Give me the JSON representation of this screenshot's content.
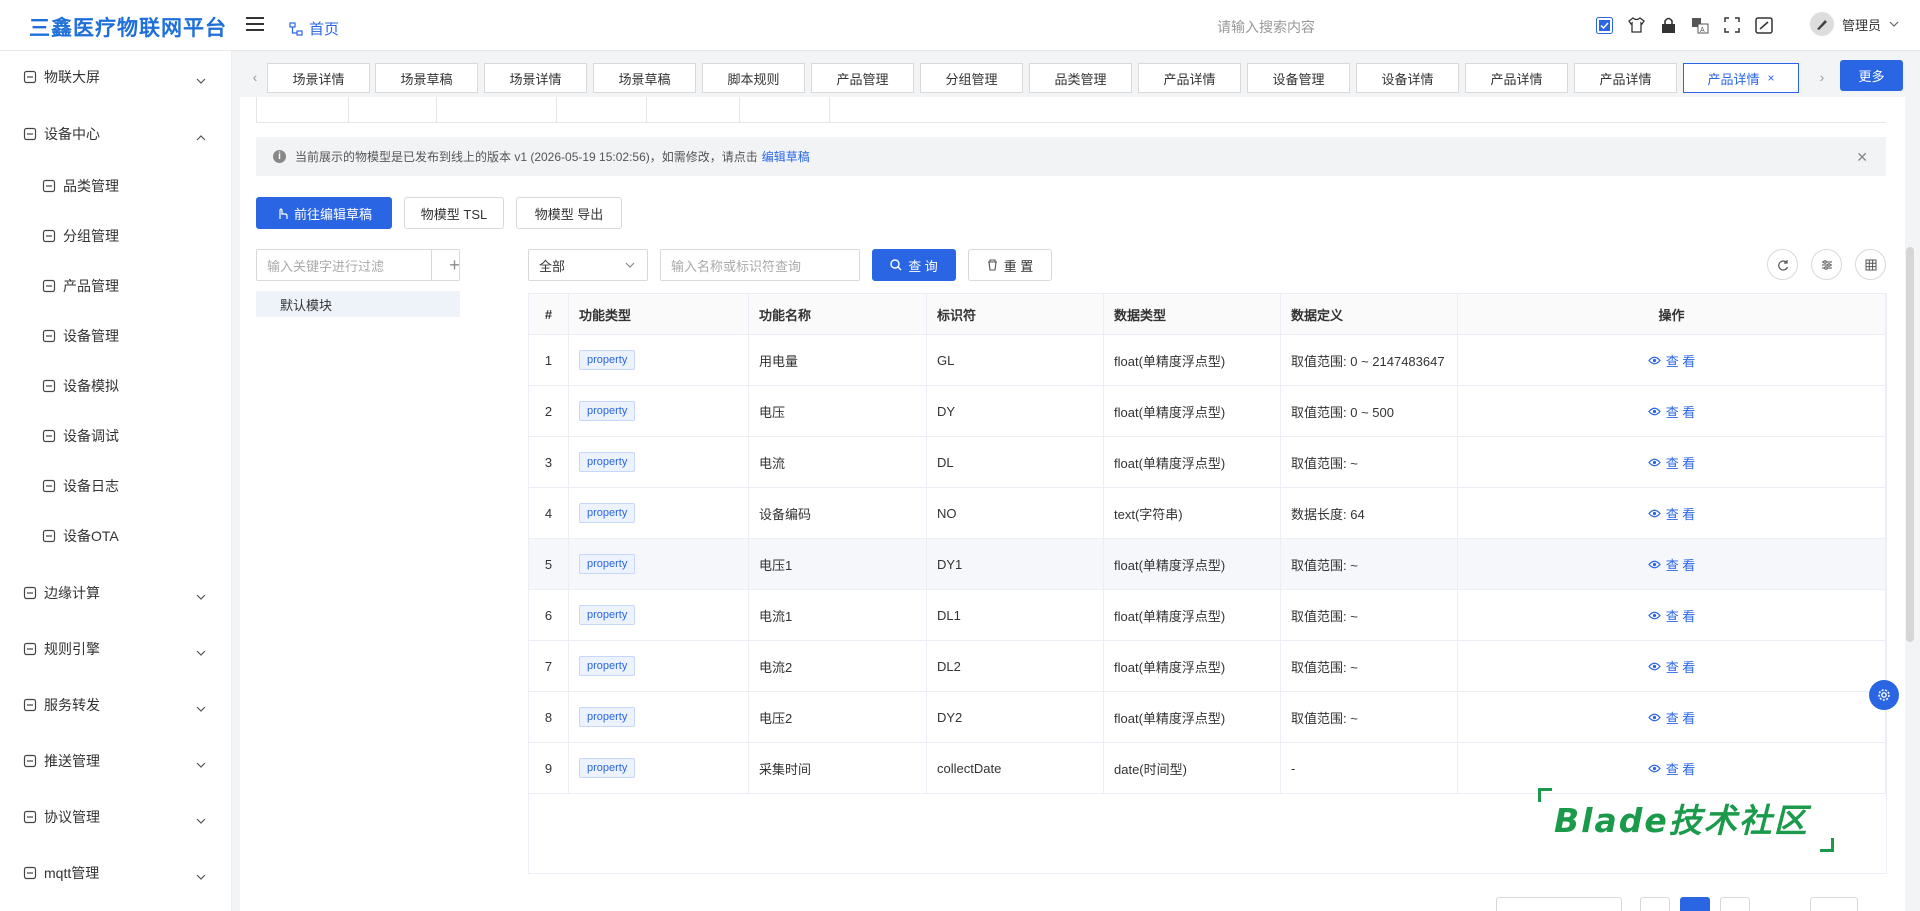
{
  "header": {
    "logo": "三鑫医疗物联网平台",
    "home_label": "首页",
    "search_placeholder": "请输入搜索内容",
    "username": "管理员"
  },
  "sidebar": {
    "items": [
      {
        "label": "物联大屏",
        "icon": "dashboard-icon",
        "chevron": "down"
      },
      {
        "label": "设备中心",
        "icon": "device-center-icon",
        "chevron": "up"
      },
      {
        "label": "品类管理",
        "icon": "cube-icon",
        "sub": true
      },
      {
        "label": "分组管理",
        "icon": "server-icon",
        "sub": true
      },
      {
        "label": "产品管理",
        "icon": "tools-icon",
        "sub": true
      },
      {
        "label": "设备管理",
        "icon": "monitor-icon",
        "sub": true
      },
      {
        "label": "设备模拟",
        "icon": "simulate-icon",
        "sub": true
      },
      {
        "label": "设备调试",
        "icon": "debug-icon",
        "sub": true
      },
      {
        "label": "设备日志",
        "icon": "log-icon",
        "sub": true
      },
      {
        "label": "设备OTA",
        "icon": "ota-icon",
        "sub": true
      },
      {
        "label": "边缘计算",
        "icon": "edge-icon",
        "chevron": "down"
      },
      {
        "label": "规则引擎",
        "icon": "rule-icon",
        "chevron": "down"
      },
      {
        "label": "服务转发",
        "icon": "forward-icon",
        "chevron": "down"
      },
      {
        "label": "推送管理",
        "icon": "bell-icon",
        "chevron": "down"
      },
      {
        "label": "协议管理",
        "icon": "antenna-icon",
        "chevron": "down"
      },
      {
        "label": "mqtt管理",
        "icon": "mqtt-icon",
        "chevron": "down"
      }
    ]
  },
  "tabs": [
    "场景详情",
    "场景草稿",
    "场景详情",
    "场景草稿",
    "脚本规则",
    "产品管理",
    "分组管理",
    "品类管理",
    "产品详情",
    "设备管理",
    "设备详情",
    "产品详情",
    "产品详情",
    "产品详情"
  ],
  "more_label": "更多",
  "alert": {
    "text": "当前展示的物模型是已发布到线上的版本 v1 (2026-05-19 15:02:56)，如需修改，请点击",
    "link": "编辑草稿"
  },
  "actions": {
    "edit_draft": "前往编辑草稿",
    "tsl": "物模型 TSL",
    "export": "物模型 导出"
  },
  "left_filter": {
    "placeholder": "输入关键字进行过滤",
    "module": "默认模块"
  },
  "query": {
    "select_value": "全部",
    "input_placeholder": "输入名称或标识符查询",
    "search_label": "查 询",
    "reset_label": "重 置"
  },
  "table": {
    "headers": [
      "#",
      "功能类型",
      "功能名称",
      "标识符",
      "数据类型",
      "数据定义",
      "操作"
    ],
    "view_label": "查 看",
    "rows": [
      {
        "no": "1",
        "type": "property",
        "name": "用电量",
        "id": "GL",
        "dtype": "float(单精度浮点型)",
        "def": "取值范围: 0 ~ 2147483647"
      },
      {
        "no": "2",
        "type": "property",
        "name": "电压",
        "id": "DY",
        "dtype": "float(单精度浮点型)",
        "def": "取值范围: 0 ~ 500"
      },
      {
        "no": "3",
        "type": "property",
        "name": "电流",
        "id": "DL",
        "dtype": "float(单精度浮点型)",
        "def": "取值范围: ~"
      },
      {
        "no": "4",
        "type": "property",
        "name": "设备编码",
        "id": "NO",
        "dtype": "text(字符串)",
        "def": "数据长度: 64"
      },
      {
        "no": "5",
        "type": "property",
        "name": "电压1",
        "id": "DY1",
        "dtype": "float(单精度浮点型)",
        "def": "取值范围: ~"
      },
      {
        "no": "6",
        "type": "property",
        "name": "电流1",
        "id": "DL1",
        "dtype": "float(单精度浮点型)",
        "def": "取值范围: ~"
      },
      {
        "no": "7",
        "type": "property",
        "name": "电流2",
        "id": "DL2",
        "dtype": "float(单精度浮点型)",
        "def": "取值范围: ~"
      },
      {
        "no": "8",
        "type": "property",
        "name": "电压2",
        "id": "DY2",
        "dtype": "float(单精度浮点型)",
        "def": "取值范围: ~"
      },
      {
        "no": "9",
        "type": "property",
        "name": "采集时间",
        "id": "collectDate",
        "dtype": "date(时间型)",
        "def": "-"
      }
    ]
  },
  "watermark": "Blade技术社区",
  "colors": {
    "primary": "#2a66e4",
    "watermark": "#1a9a4a"
  }
}
